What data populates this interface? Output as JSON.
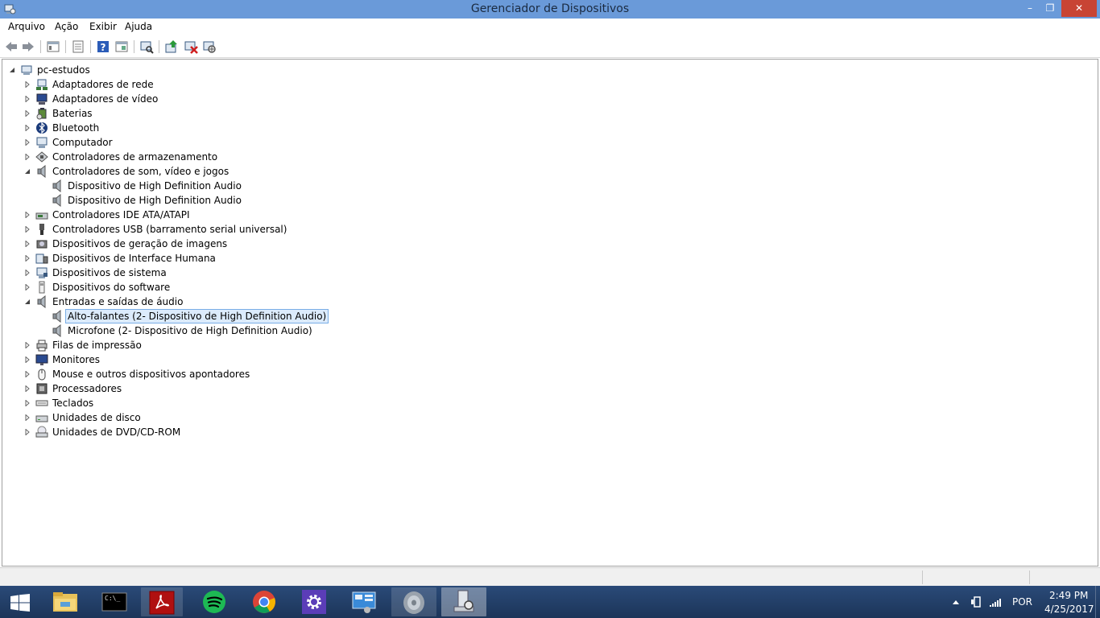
{
  "window": {
    "title": "Gerenciador de Dispositivos",
    "minimize": "–",
    "maximize": "❐",
    "close": "✕"
  },
  "menu": [
    "Arquivo",
    "Ação",
    "Exibir",
    "Ajuda"
  ],
  "toolbar": {
    "icons": [
      "back-icon",
      "forward-icon",
      "view-icon",
      "properties-icon",
      "help-icon",
      "view-devices-icon",
      "scan-hardware-icon",
      "update-driver-icon",
      "uninstall-icon",
      "disable-icon"
    ]
  },
  "tree": {
    "root": "pc-estudos",
    "items": [
      {
        "label": "Adaptadores de rede",
        "level": 1,
        "expander": "collapsed",
        "icon": "network-adapter-icon"
      },
      {
        "label": "Adaptadores de vídeo",
        "level": 1,
        "expander": "collapsed",
        "icon": "display-adapter-icon"
      },
      {
        "label": "Baterias",
        "level": 1,
        "expander": "collapsed",
        "icon": "battery-icon"
      },
      {
        "label": "Bluetooth",
        "level": 1,
        "expander": "collapsed",
        "icon": "bluetooth-icon"
      },
      {
        "label": "Computador",
        "level": 1,
        "expander": "collapsed",
        "icon": "computer-icon"
      },
      {
        "label": "Controladores de armazenamento",
        "level": 1,
        "expander": "collapsed",
        "icon": "storage-controller-icon"
      },
      {
        "label": "Controladores de som, vídeo e jogos",
        "level": 1,
        "expander": "expanded",
        "icon": "speaker-icon"
      },
      {
        "label": "Dispositivo de High Definition Audio",
        "level": 2,
        "expander": "none",
        "icon": "speaker-icon"
      },
      {
        "label": "Dispositivo de High Definition Audio",
        "level": 2,
        "expander": "none",
        "icon": "speaker-icon"
      },
      {
        "label": "Controladores IDE ATA/ATAPI",
        "level": 1,
        "expander": "collapsed",
        "icon": "ide-controller-icon"
      },
      {
        "label": "Controladores USB (barramento serial universal)",
        "level": 1,
        "expander": "collapsed",
        "icon": "usb-icon"
      },
      {
        "label": "Dispositivos de geração de imagens",
        "level": 1,
        "expander": "collapsed",
        "icon": "camera-icon"
      },
      {
        "label": "Dispositivos de Interface Humana",
        "level": 1,
        "expander": "collapsed",
        "icon": "hid-icon"
      },
      {
        "label": "Dispositivos de sistema",
        "level": 1,
        "expander": "collapsed",
        "icon": "system-device-icon"
      },
      {
        "label": "Dispositivos do software",
        "level": 1,
        "expander": "collapsed",
        "icon": "software-device-icon"
      },
      {
        "label": "Entradas e saídas de áudio",
        "level": 1,
        "expander": "expanded",
        "icon": "speaker-icon"
      },
      {
        "label": "Alto-falantes (2- Dispositivo de High Definition Audio)",
        "level": 2,
        "expander": "none",
        "icon": "speaker-icon",
        "selected": true
      },
      {
        "label": "Microfone (2- Dispositivo de High Definition Audio)",
        "level": 2,
        "expander": "none",
        "icon": "speaker-icon"
      },
      {
        "label": "Filas de impressão",
        "level": 1,
        "expander": "collapsed",
        "icon": "printer-icon"
      },
      {
        "label": "Monitores",
        "level": 1,
        "expander": "collapsed",
        "icon": "monitor-icon"
      },
      {
        "label": "Mouse e outros dispositivos apontadores",
        "level": 1,
        "expander": "collapsed",
        "icon": "mouse-icon"
      },
      {
        "label": "Processadores",
        "level": 1,
        "expander": "collapsed",
        "icon": "processor-icon"
      },
      {
        "label": "Teclados",
        "level": 1,
        "expander": "collapsed",
        "icon": "keyboard-icon"
      },
      {
        "label": "Unidades de disco",
        "level": 1,
        "expander": "collapsed",
        "icon": "disk-drive-icon"
      },
      {
        "label": "Unidades de DVD/CD-ROM",
        "level": 1,
        "expander": "collapsed",
        "icon": "dvd-drive-icon"
      }
    ]
  },
  "taskbar": {
    "apps": [
      {
        "name": "start-button",
        "icon": "windows-logo-icon"
      },
      {
        "name": "file-explorer-button",
        "icon": "folder-icon"
      },
      {
        "name": "command-prompt-button",
        "icon": "terminal-icon",
        "text": "C:\\_"
      },
      {
        "name": "acrobat-button",
        "icon": "pdf-icon"
      },
      {
        "name": "spotify-button",
        "icon": "spotify-icon"
      },
      {
        "name": "chrome-button",
        "icon": "chrome-icon"
      },
      {
        "name": "settings-button",
        "icon": "gear-icon"
      },
      {
        "name": "control-panel-button",
        "icon": "control-panel-icon"
      },
      {
        "name": "sound-button",
        "icon": "speaker-icon"
      },
      {
        "name": "device-manager-button",
        "icon": "device-manager-icon"
      }
    ],
    "tray": {
      "language": "POR",
      "time": "2:49 PM",
      "date": "4/25/2017"
    }
  },
  "colors": {
    "titlebar": "#6a9ad9",
    "close": "#c84434",
    "selection_bg": "#dcebfc",
    "selection_border": "#7aaee6",
    "taskbar": "#1c3559"
  }
}
